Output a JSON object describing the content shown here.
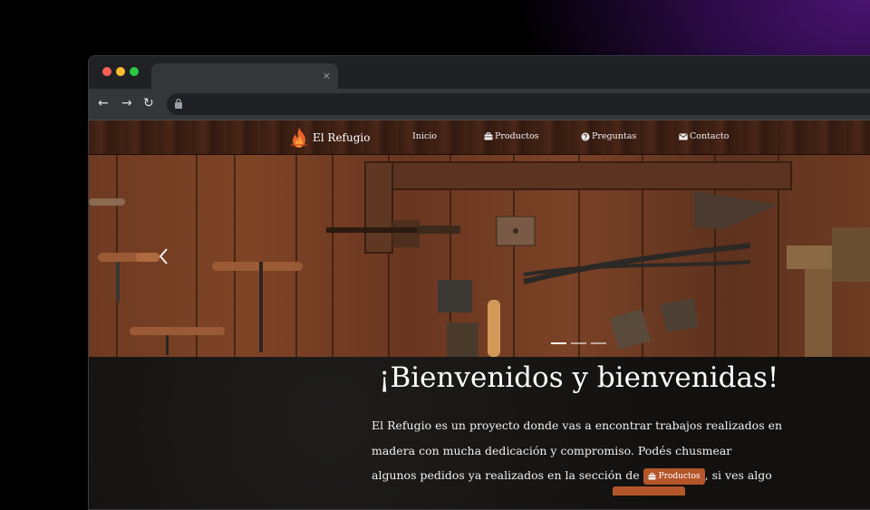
{
  "browser": {
    "tab_close": "×",
    "nav": {
      "back": "←",
      "forward": "→",
      "reload": "↻"
    }
  },
  "site": {
    "brand": "El Refugio",
    "nav": [
      {
        "label": "Inicio",
        "icon": "none"
      },
      {
        "label": "Productos",
        "icon": "briefcase-icon"
      },
      {
        "label": "Preguntas",
        "icon": "question-circle-icon"
      },
      {
        "label": "Contacto",
        "icon": "envelope-icon"
      }
    ]
  },
  "carousel": {
    "slide_count": 3,
    "active_index": 0
  },
  "welcome": {
    "title": "¡Bienvenidos y bienvenidas!",
    "line1": "El Refugio es un proyecto donde vas a encontrar trabajos realizados en",
    "line2": "madera con mucha dedicación y compromiso. Podés chusmear",
    "line3_before": "algunos pedidos ya realizados en la sección de",
    "line3_button": "Productos",
    "line3_after": ", si ves algo"
  },
  "colors": {
    "accent": "#b5562a",
    "nav_wood": "#3d2014",
    "background_dark": "#141312"
  }
}
